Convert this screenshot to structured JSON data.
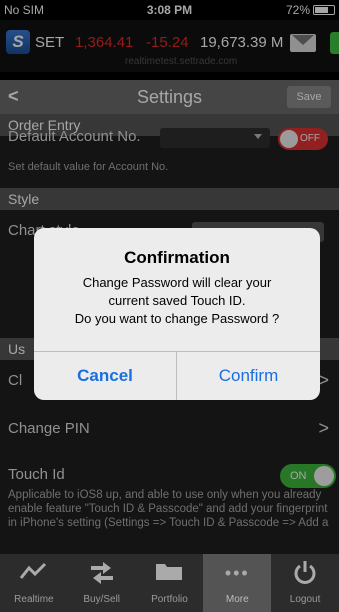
{
  "status_bar": {
    "carrier": "No SIM",
    "time": "3:08 PM",
    "battery": "72%",
    "battery_level": 0.72
  },
  "ticker": {
    "index": "SET",
    "price": "1,364.41",
    "change": "-15.24",
    "volume": "19,673.39 M",
    "subtitle": "realtimetest.settrade.com"
  },
  "navbar": {
    "back": "<",
    "title": "Settings",
    "save": "Save"
  },
  "sections": {
    "order_entry": {
      "header": "Order Entry",
      "default_account_label": "Default Account No.",
      "toggle": "OFF",
      "hint": "Set default value for Account No."
    },
    "style": {
      "header": "Style",
      "chart_label": "Chart style"
    },
    "user": {
      "header": "Us",
      "change_password_label": "Cl",
      "change_pin_label": "Change PIN",
      "touch_id_label": "Touch Id",
      "touch_id_toggle": "ON",
      "touch_id_hint": "Applicable to iOS8 up, and able to use only when you already enable feature \"Touch ID & Passcode\" and add your fingerprint in iPhone's setting (Settings => Touch ID & Passcode => Add a"
    }
  },
  "dialog": {
    "title": "Confirmation",
    "message_line1": "Change Password will clear your",
    "message_line2": "current saved Touch ID.",
    "message_line3": "Do you want to change Password ?",
    "cancel": "Cancel",
    "confirm": "Confirm"
  },
  "tabs": [
    {
      "label": "Realtime",
      "icon": "chart-line-icon"
    },
    {
      "label": "Buy/Sell",
      "icon": "transfer-arrows-icon"
    },
    {
      "label": "Portfolio",
      "icon": "folder-icon"
    },
    {
      "label": "More",
      "icon": "more-dots-icon",
      "active": true
    },
    {
      "label": "Logout",
      "icon": "power-icon"
    }
  ],
  "colors": {
    "accent": "#1a6fe0",
    "negative": "#e52a2a",
    "toggle_on": "#3cb73c",
    "toggle_off": "#e03232"
  }
}
